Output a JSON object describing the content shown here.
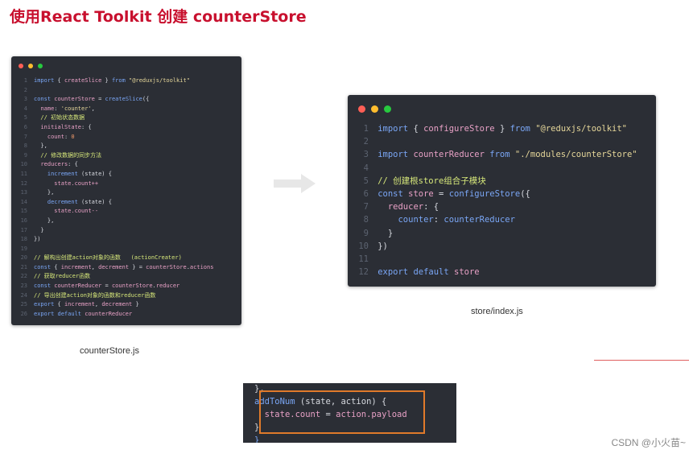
{
  "title": "使用React Toolkit 创建 counterStore",
  "left_window": {
    "caption": "counterStore.js",
    "lines": [
      {
        "n": "1",
        "segs": [
          [
            "k",
            "import "
          ],
          [
            "p",
            "{ "
          ],
          [
            "v",
            "createSlice"
          ],
          [
            "p",
            " } "
          ],
          [
            "k",
            "from "
          ],
          [
            "s",
            "\"@reduxjs/toolkit\""
          ]
        ]
      },
      {
        "n": "2",
        "segs": []
      },
      {
        "n": "3",
        "segs": [
          [
            "k",
            "const "
          ],
          [
            "v",
            "counterStore"
          ],
          [
            "p",
            " = "
          ],
          [
            "f",
            "createSlice"
          ],
          [
            "p",
            "({"
          ]
        ]
      },
      {
        "n": "4",
        "segs": [
          [
            "p",
            "  "
          ],
          [
            "v",
            "name"
          ],
          [
            "p",
            ": "
          ],
          [
            "s",
            "'counter'"
          ],
          [
            "p",
            ","
          ]
        ]
      },
      {
        "n": "5",
        "segs": [
          [
            "c",
            "  // 初始状态数据"
          ]
        ]
      },
      {
        "n": "6",
        "segs": [
          [
            "p",
            "  "
          ],
          [
            "v",
            "initialState"
          ],
          [
            "p",
            ": {"
          ]
        ]
      },
      {
        "n": "7",
        "segs": [
          [
            "p",
            "    "
          ],
          [
            "v",
            "count"
          ],
          [
            "p",
            ": "
          ],
          [
            "n",
            "0"
          ]
        ]
      },
      {
        "n": "8",
        "segs": [
          [
            "p",
            "  },"
          ]
        ]
      },
      {
        "n": "9",
        "segs": [
          [
            "c",
            "  // 修改数据的同步方法"
          ]
        ]
      },
      {
        "n": "10",
        "segs": [
          [
            "p",
            "  "
          ],
          [
            "v",
            "reducers"
          ],
          [
            "p",
            ": {"
          ]
        ]
      },
      {
        "n": "11",
        "segs": [
          [
            "p",
            "    "
          ],
          [
            "f",
            "increment"
          ],
          [
            "p",
            " (state) {"
          ]
        ]
      },
      {
        "n": "12",
        "segs": [
          [
            "p",
            "      "
          ],
          [
            "v",
            "state.count++"
          ]
        ]
      },
      {
        "n": "13",
        "segs": [
          [
            "p",
            "    },"
          ]
        ]
      },
      {
        "n": "14",
        "segs": [
          [
            "p",
            "    "
          ],
          [
            "f",
            "decrement"
          ],
          [
            "p",
            " (state) {"
          ]
        ]
      },
      {
        "n": "15",
        "segs": [
          [
            "p",
            "      "
          ],
          [
            "v",
            "state.count--"
          ]
        ]
      },
      {
        "n": "16",
        "segs": [
          [
            "p",
            "    },"
          ]
        ]
      },
      {
        "n": "17",
        "segs": [
          [
            "p",
            "  }"
          ]
        ]
      },
      {
        "n": "18",
        "segs": [
          [
            "p",
            "})"
          ]
        ]
      },
      {
        "n": "19",
        "segs": []
      },
      {
        "n": "20",
        "segs": [
          [
            "c",
            "// 解构出创建action对象的函数   (actionCreater)"
          ]
        ]
      },
      {
        "n": "21",
        "segs": [
          [
            "k",
            "const "
          ],
          [
            "p",
            "{ "
          ],
          [
            "v",
            "increment"
          ],
          [
            "p",
            ", "
          ],
          [
            "v",
            "decrement"
          ],
          [
            "p",
            " } = "
          ],
          [
            "v",
            "counterStore"
          ],
          [
            "p",
            "."
          ],
          [
            "v",
            "actions"
          ]
        ]
      },
      {
        "n": "22",
        "segs": [
          [
            "c",
            "// 获取reducer函数"
          ]
        ]
      },
      {
        "n": "23",
        "segs": [
          [
            "k",
            "const "
          ],
          [
            "v",
            "counterReducer"
          ],
          [
            "p",
            " = "
          ],
          [
            "v",
            "counterStore"
          ],
          [
            "p",
            "."
          ],
          [
            "v",
            "reducer"
          ]
        ]
      },
      {
        "n": "24",
        "segs": [
          [
            "c",
            "// 导出创建action对象的函数和reducer函数"
          ]
        ]
      },
      {
        "n": "25",
        "segs": [
          [
            "k",
            "export "
          ],
          [
            "p",
            "{ "
          ],
          [
            "v",
            "increment"
          ],
          [
            "p",
            ", "
          ],
          [
            "v",
            "decrement"
          ],
          [
            "p",
            " }"
          ]
        ]
      },
      {
        "n": "26",
        "segs": [
          [
            "k",
            "export default "
          ],
          [
            "v",
            "counterReducer"
          ]
        ]
      }
    ]
  },
  "right_window": {
    "caption": "store/index.js",
    "lines": [
      {
        "n": "1",
        "segs": [
          [
            "k",
            "import "
          ],
          [
            "p",
            "{ "
          ],
          [
            "v",
            "configureStore"
          ],
          [
            "p",
            " } "
          ],
          [
            "k",
            "from "
          ],
          [
            "s",
            "\"@reduxjs/toolkit\""
          ]
        ]
      },
      {
        "n": "2",
        "segs": []
      },
      {
        "n": "3",
        "segs": [
          [
            "k",
            "import "
          ],
          [
            "v",
            "counterReducer"
          ],
          [
            "k",
            " from "
          ],
          [
            "s",
            "\"./modules/counterStore\""
          ]
        ]
      },
      {
        "n": "4",
        "segs": []
      },
      {
        "n": "5",
        "segs": [
          [
            "c",
            "// 创建根store组合子模块"
          ]
        ]
      },
      {
        "n": "6",
        "segs": [
          [
            "k",
            "const "
          ],
          [
            "v",
            "store"
          ],
          [
            "p",
            " = "
          ],
          [
            "f",
            "configureStore"
          ],
          [
            "p",
            "({"
          ]
        ]
      },
      {
        "n": "7",
        "segs": [
          [
            "p",
            "  "
          ],
          [
            "v",
            "reducer"
          ],
          [
            "p",
            ": {"
          ]
        ]
      },
      {
        "n": "8",
        "segs": [
          [
            "p",
            "    "
          ],
          [
            "f",
            "counter"
          ],
          [
            "p",
            ": "
          ],
          [
            "f",
            "counterReducer"
          ]
        ]
      },
      {
        "n": "9",
        "segs": [
          [
            "p",
            "  }"
          ]
        ]
      },
      {
        "n": "10",
        "segs": [
          [
            "p",
            "})"
          ]
        ]
      },
      {
        "n": "11",
        "segs": []
      },
      {
        "n": "12",
        "segs": [
          [
            "k",
            "export default "
          ],
          [
            "v",
            "store"
          ]
        ]
      }
    ]
  },
  "snippet": {
    "lines": [
      {
        "segs": [
          [
            "p",
            "},"
          ]
        ]
      },
      {
        "segs": [
          [
            "f",
            "addToNum"
          ],
          [
            "p",
            " (state, action) {"
          ]
        ]
      },
      {
        "segs": [
          [
            "p",
            "  "
          ],
          [
            "v",
            "state.count"
          ],
          [
            "p",
            " = "
          ],
          [
            "v",
            "action.payload"
          ]
        ]
      },
      {
        "segs": [
          [
            "p",
            "}"
          ]
        ]
      },
      {
        "segs": [
          [
            "f",
            "}"
          ]
        ]
      }
    ]
  },
  "colors": {
    "dot_red": "#ff5f56",
    "dot_yellow": "#ffbd2e",
    "dot_green": "#27c93f",
    "title": "#c8102e",
    "highlight": "#e07a2a"
  },
  "watermark": "CSDN @小火苗~"
}
